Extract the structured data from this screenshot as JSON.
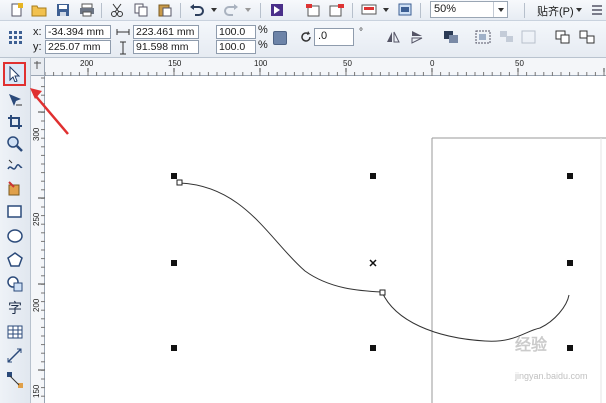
{
  "standard_toolbar": {
    "zoom_value": "50%",
    "snap_label": "贴齐(P)"
  },
  "property_bar": {
    "x_label": "x:",
    "x_value": "-34.394 mm",
    "y_label": "y:",
    "y_value": "225.07 mm",
    "width_value": "223.461 mm",
    "height_value": "91.598 mm",
    "scale_w": "100.0",
    "scale_h": "100.0",
    "percent_sign": "%",
    "rotation_value": ".0",
    "degree_sign": "°"
  },
  "horizontal_ruler": {
    "ticks": [
      "200",
      "150",
      "100",
      "50",
      "0",
      "50"
    ]
  },
  "vertical_ruler": {
    "ticks": [
      "300",
      "250",
      "200",
      "150"
    ]
  },
  "toolbox": {
    "active_tool": "pick-tool",
    "text_tool_glyph": "字"
  },
  "watermark": {
    "main": "经验",
    "sub": "jingyan.baidu.com"
  },
  "colors": {
    "annotation_red": "#e03030",
    "toolbar_bg": "#e7ecf3"
  }
}
